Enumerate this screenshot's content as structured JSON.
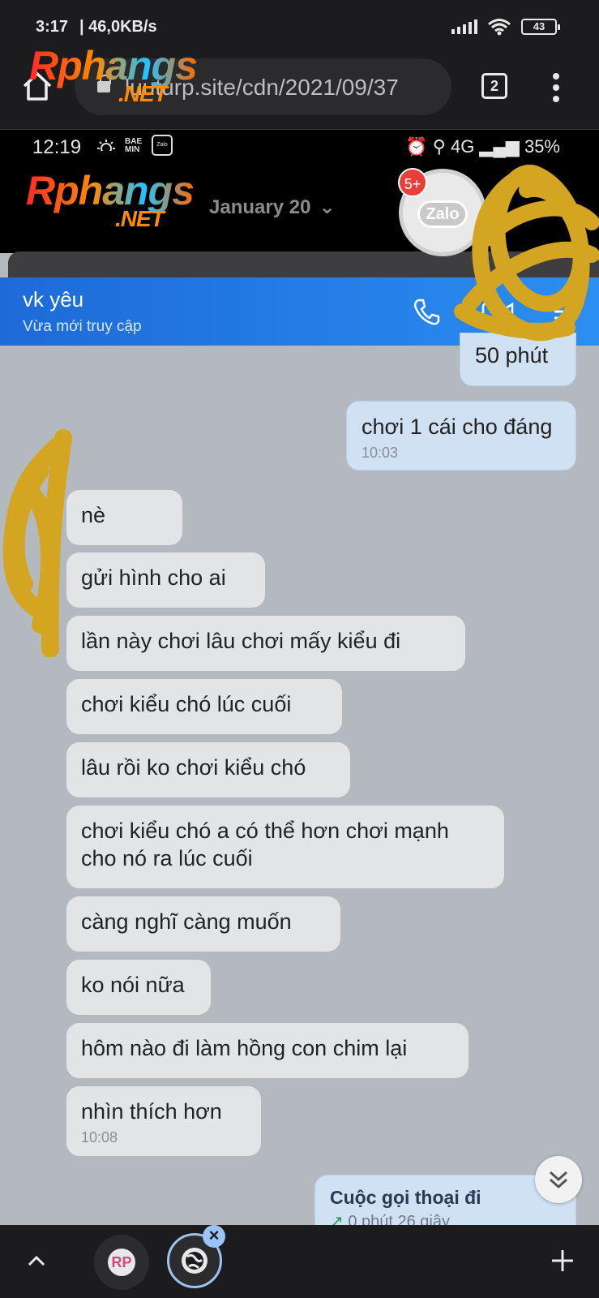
{
  "outer_status": {
    "time": "3:17",
    "speed": "| 46,0KB/s",
    "battery": "43"
  },
  "browser": {
    "url": "luuturp.site/cdn/2021/09/37",
    "tab_count": "2"
  },
  "watermark": {
    "text_main": "Rphangs",
    "text_sub": ".NET"
  },
  "inner_status": {
    "time": "12:19",
    "bae": "BAE",
    "min": "MIN",
    "zalo_mini": "Zalo",
    "right_icons": "⏰ ⚲ 4G ▂▄▆ 35%"
  },
  "notification": {
    "month": "January 20",
    "zalo_label": "Zalo",
    "badge": "5+"
  },
  "chat": {
    "name": "vk yêu",
    "status": "Vừa mới truy cập",
    "messages": [
      {
        "dir": "out",
        "text": "50 phút",
        "time": ""
      },
      {
        "dir": "out",
        "text": "chơi 1 cái cho đáng",
        "time": "10:03"
      },
      {
        "dir": "in",
        "text": "nè",
        "time": ""
      },
      {
        "dir": "in",
        "text": "gửi hình  cho  ai",
        "time": ""
      },
      {
        "dir": "in",
        "text": "lần  này  chơi  lâu  chơi  mấy kiểu đi",
        "time": ""
      },
      {
        "dir": "in",
        "text": "chơi  kiểu  chó  lúc cuối",
        "time": ""
      },
      {
        "dir": "in",
        "text": "lâu rồi ko chơi  kiểu  chó",
        "time": ""
      },
      {
        "dir": "in",
        "text": "chơi  kiểu chó  a có thể hơn  chơi mạnh cho nó ra  lúc  cuối",
        "time": ""
      },
      {
        "dir": "in",
        "text": "càng  nghĩ  càng  muốn",
        "time": ""
      },
      {
        "dir": "in",
        "text": "ko nói nữa",
        "time": ""
      },
      {
        "dir": "in",
        "text": "hôm nào  đi làm  hồng  con chim lại",
        "time": ""
      },
      {
        "dir": "in",
        "text": "nhìn  thích  hơn",
        "time": "10:08"
      }
    ],
    "call_card": {
      "title": "Cuộc gọi thoại đi",
      "detail": "0 phút 26 giây"
    }
  },
  "bottom_bar": {
    "rp_label": "RP"
  },
  "colors": {
    "header_blue": "#2b8ef0",
    "chat_bg": "#b4b9c0",
    "incoming_bubble": "#e3e4e6",
    "outgoing_bubble": "#cfe1f3",
    "scribble": "#d4a520"
  }
}
